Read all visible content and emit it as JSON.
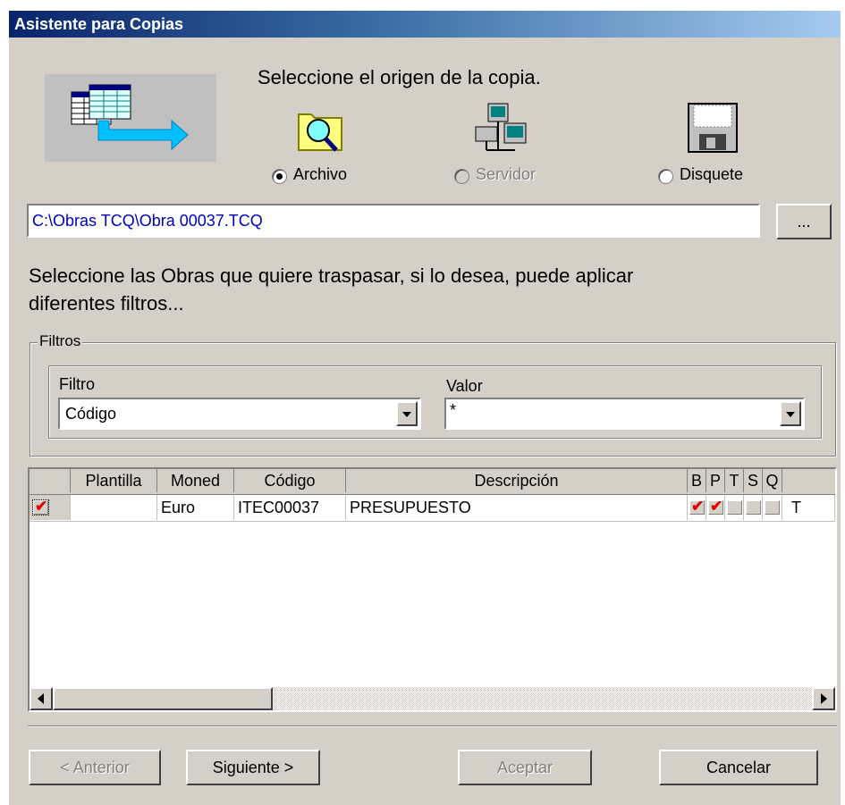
{
  "window": {
    "title": "Asistente para Copias"
  },
  "source": {
    "prompt": "Seleccione el origen de la copia.",
    "options": [
      {
        "label": "Archivo",
        "selected": true,
        "enabled": true
      },
      {
        "label": "Servidor",
        "selected": false,
        "enabled": false
      },
      {
        "label": "Disquete",
        "selected": false,
        "enabled": true
      }
    ]
  },
  "path": {
    "value": "C:\\Obras TCQ\\Obra 00037.TCQ",
    "browse_label": "..."
  },
  "instructions": {
    "line1": "Seleccione las Obras que quiere traspasar, si lo desea, puede aplicar",
    "line2": "diferentes filtros..."
  },
  "filters": {
    "group_label": "Filtros",
    "filter_label": "Filtro",
    "filter_value": "Código",
    "value_label": "Valor",
    "value_value": "*"
  },
  "grid": {
    "columns": [
      "Plantilla",
      "Moned",
      "Código",
      "Descripción",
      "B",
      "P",
      "T",
      "S",
      "Q"
    ],
    "rows": [
      {
        "selected": true,
        "plantilla": "",
        "moneda": "Euro",
        "codigo": "ITEC00037",
        "descripcion": "PRESUPUESTO",
        "b": true,
        "p": true,
        "t": false,
        "s": false,
        "q": false,
        "extra": "T"
      }
    ]
  },
  "buttons": {
    "anterior": "< Anterior",
    "siguiente": "Siguiente >",
    "aceptar": "Aceptar",
    "cancelar": "Cancelar"
  },
  "colors": {
    "path_text": "#0000c0",
    "check": "#e00000",
    "title_start": "#0a246a",
    "title_end": "#a6caf0"
  }
}
